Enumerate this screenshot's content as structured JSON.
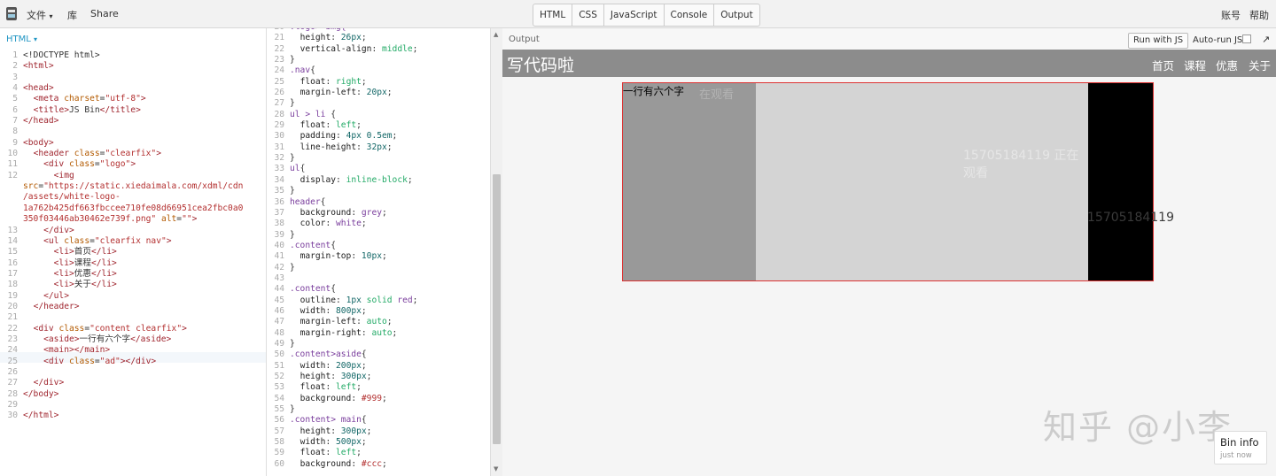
{
  "topbar": {
    "menu": [
      "文件",
      "库",
      "Share"
    ],
    "file_caret": "▾",
    "panels": [
      "HTML",
      "CSS",
      "JavaScript",
      "Console",
      "Output"
    ],
    "right": [
      "账号",
      "帮助"
    ]
  },
  "html_panel": {
    "label": "HTML",
    "label_caret": "▾"
  },
  "output": {
    "label": "Output",
    "run_button": "Run with JS",
    "autorun_label": "Auto-run JS",
    "popout": "↗",
    "site_logo": "写代码啦",
    "nav": [
      "首页",
      "课程",
      "优惠",
      "关于"
    ],
    "aside_text": "一行有六个字",
    "watermark_1": "在观看",
    "watermark_2": "15705184119 正在观看",
    "watermark_3": "15705184119",
    "watermark_big": "知乎 @小李",
    "bininfo_title": "Bin info",
    "bininfo_sub": "just now"
  },
  "colors": {
    "header_bg": "#8c8c8c",
    "aside_bg": "#999999",
    "main_bg": "#cccccc",
    "ad_bg": "#000000",
    "outline": "#ff0000"
  }
}
